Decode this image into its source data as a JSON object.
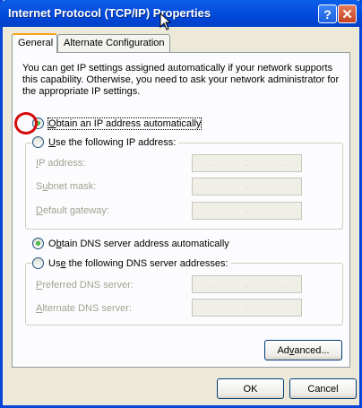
{
  "window": {
    "title": "Internet Protocol (TCP/IP) Properties",
    "help_glyph": "?",
    "close_glyph": "✕"
  },
  "tabs": [
    {
      "label": "General",
      "active": true
    },
    {
      "label": "Alternate Configuration",
      "active": false
    }
  ],
  "intro_text": "You can get IP settings assigned automatically if your network supports this capability. Otherwise, you need to ask your network administrator for the appropriate IP settings.",
  "ip": {
    "auto_radio": {
      "accel": "O",
      "rest": "btain an IP address automatically",
      "selected": true
    },
    "manual_radio": {
      "accel": "U",
      "rest": "se the following IP address:",
      "selected": false
    },
    "fields": [
      {
        "accel": "I",
        "rest": "P address:"
      },
      {
        "pre": "S",
        "accel": "u",
        "rest": "bnet mask:"
      },
      {
        "accel": "D",
        "rest": "efault gateway:"
      }
    ]
  },
  "dns": {
    "auto_radio": {
      "pre": "O",
      "accel": "b",
      "rest": "tain DNS server address automatically",
      "selected": true
    },
    "manual_radio": {
      "pre": "Us",
      "accel": "e",
      "rest": " the following DNS server addresses:",
      "selected": false
    },
    "fields": [
      {
        "accel": "P",
        "rest": "referred DNS server:"
      },
      {
        "accel": "A",
        "rest": "lternate DNS server:"
      }
    ]
  },
  "ip_dots": ".",
  "buttons": {
    "advanced": {
      "pre": "Ad",
      "accel": "v",
      "rest": "anced..."
    },
    "ok": "OK",
    "cancel": "Cancel"
  },
  "colors": {
    "titlebar": "#0b57e4",
    "highlight_ring": "#d50a0a",
    "dialog_bg": "#ece9d8"
  }
}
